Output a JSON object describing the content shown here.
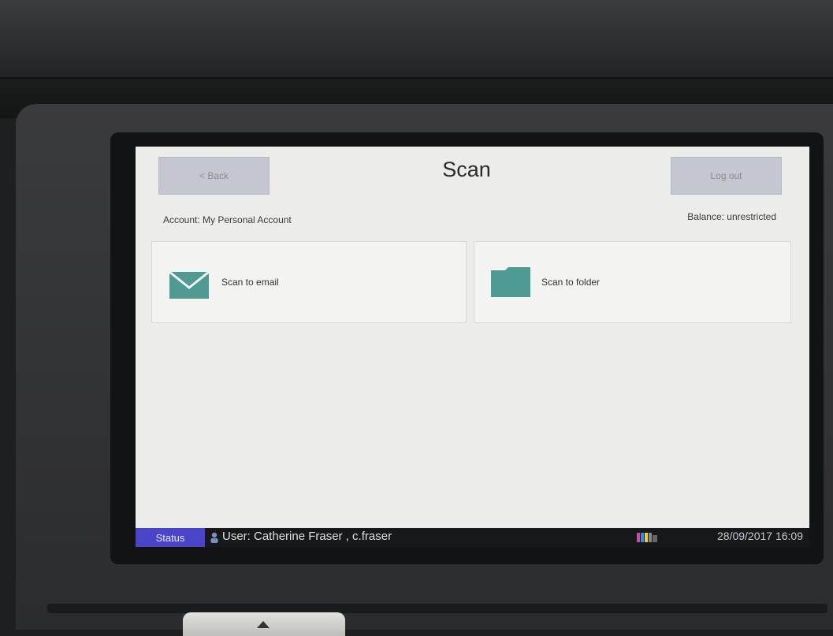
{
  "header": {
    "back_label": "< Back",
    "title": "Scan",
    "logout_label": "Log out"
  },
  "account": {
    "account_text": "Account: My Personal Account",
    "balance_text": "Balance: unrestricted"
  },
  "options": [
    {
      "label": "Scan to email",
      "icon": "envelope-icon"
    },
    {
      "label": "Scan to folder",
      "icon": "folder-icon"
    }
  ],
  "statusbar": {
    "status_label": "Status",
    "user_text": "User: Catherine Fraser , c.fraser",
    "datetime": "28/09/2017 16:09"
  },
  "colors": {
    "accent_teal": "#4f9a93",
    "status_button": "#4a44c8",
    "button_gray": "#c4c7cf"
  }
}
